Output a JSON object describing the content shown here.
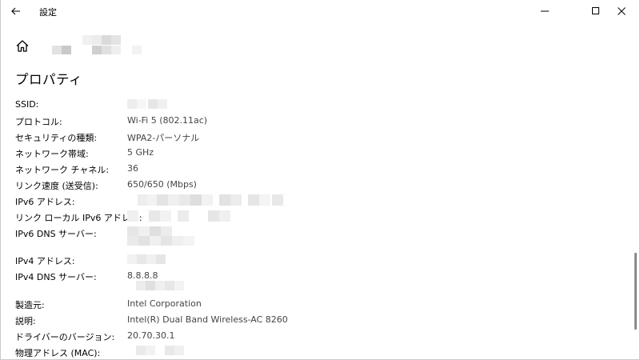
{
  "window": {
    "title": "設定",
    "icons": {
      "back": "arrow-left-icon",
      "minimize": "minimize-icon",
      "maximize": "maximize-icon",
      "close": "close-icon",
      "home": "home-icon"
    }
  },
  "section": {
    "heading": "プロパティ"
  },
  "properties": [
    {
      "label": "SSID:",
      "value": ""
    },
    {
      "label": "プロトコル:",
      "value": "Wi-Fi 5 (802.11ac)"
    },
    {
      "label": "セキュリティの種類:",
      "value": "WPA2-パーソナル"
    },
    {
      "label": "ネットワーク帯域:",
      "value": "5 GHz"
    },
    {
      "label": "ネットワーク チャネル:",
      "value": "36"
    },
    {
      "label": "リンク速度 (送受信):",
      "value": "650/650 (Mbps)"
    },
    {
      "label": "IPv6 アドレス:",
      "value": ""
    },
    {
      "label": "リンク ローカル IPv6 アドレス:",
      "value": ""
    },
    {
      "label": "IPv6 DNS サーバー:",
      "value": ""
    },
    {
      "label": "IPv4 アドレス:",
      "value": ""
    },
    {
      "label": "IPv4 DNS サーバー:",
      "value": "8.8.8.8"
    },
    {
      "label": "製造元:",
      "value": "Intel Corporation"
    },
    {
      "label": "説明:",
      "value": "Intel(R) Dual Band Wireless-AC 8260"
    },
    {
      "label": "ドライバーのバージョン:",
      "value": "20.70.30.1"
    },
    {
      "label": "物理アドレス (MAC):",
      "value": ""
    }
  ]
}
